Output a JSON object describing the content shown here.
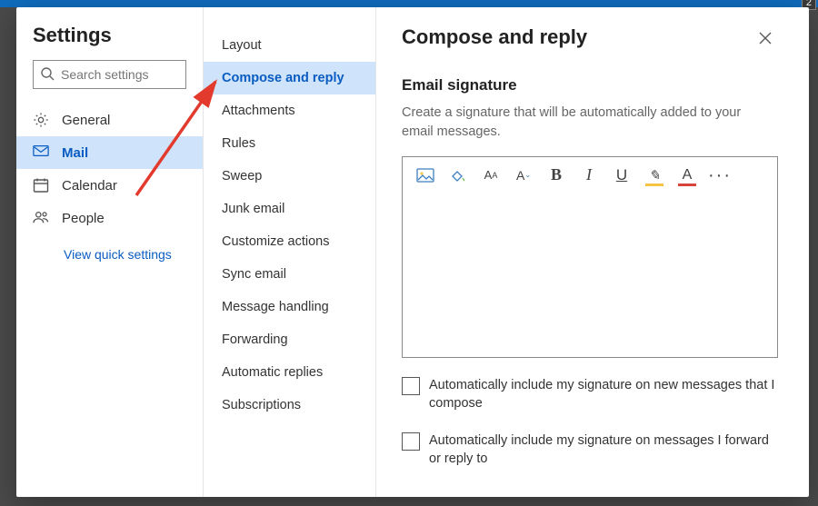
{
  "header": {
    "title": "Settings",
    "search_placeholder": "Search settings"
  },
  "categories": [
    {
      "key": "general",
      "label": "General",
      "icon": "gear"
    },
    {
      "key": "mail",
      "label": "Mail",
      "icon": "mail",
      "active": true
    },
    {
      "key": "calendar",
      "label": "Calendar",
      "icon": "calendar"
    },
    {
      "key": "people",
      "label": "People",
      "icon": "people"
    }
  ],
  "quick_settings_label": "View quick settings",
  "subsections": [
    {
      "label": "Layout"
    },
    {
      "label": "Compose and reply",
      "active": true
    },
    {
      "label": "Attachments"
    },
    {
      "label": "Rules"
    },
    {
      "label": "Sweep"
    },
    {
      "label": "Junk email"
    },
    {
      "label": "Customize actions"
    },
    {
      "label": "Sync email"
    },
    {
      "label": "Message handling"
    },
    {
      "label": "Forwarding"
    },
    {
      "label": "Automatic replies"
    },
    {
      "label": "Subscriptions"
    }
  ],
  "detail": {
    "heading": "Compose and reply",
    "section_title": "Email signature",
    "section_desc": "Create a signature that will be automatically added to your email messages.",
    "toolbar_icons": [
      "image",
      "style",
      "font-size",
      "font-size-dropdown",
      "bold",
      "italic",
      "underline",
      "highlight",
      "font-color",
      "more"
    ],
    "checkbox1_label": "Automatically include my signature on new messages that I compose",
    "checkbox2_label": "Automatically include my signature on messages I forward or reply to"
  },
  "badge_value": "2"
}
